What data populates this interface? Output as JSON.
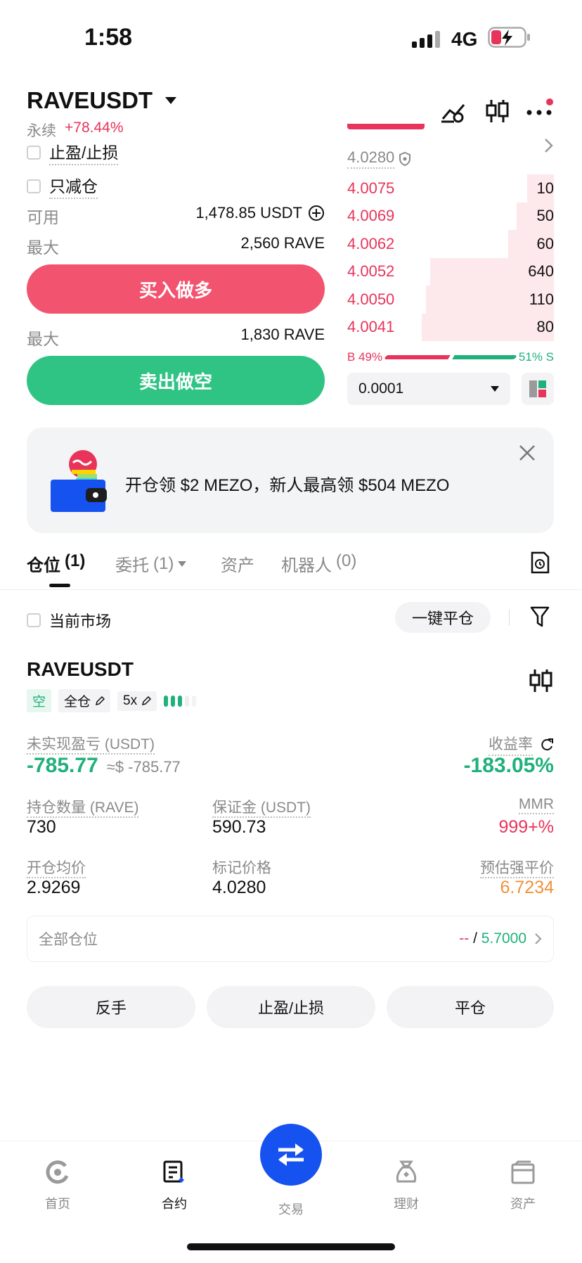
{
  "status": {
    "time": "1:58",
    "network": "4G"
  },
  "header": {
    "pair": "RAVEUSDT",
    "type": "永续",
    "change": "+78.44%"
  },
  "order_form": {
    "tp_sl_label": "止盈/止损",
    "reduce_only_label": "只减仓",
    "available_label": "可用",
    "available_value": "1,478.85 USDT",
    "max_label": "最大",
    "max_buy_value": "2,560 RAVE",
    "buy_button": "买入做多",
    "max_sell_value": "1,830 RAVE",
    "sell_button": "卖出做空"
  },
  "orderbook": {
    "mark_price": "4.0280",
    "asks": [
      {
        "price": "4.0075",
        "qty": "10",
        "depth": 0.13
      },
      {
        "price": "4.0069",
        "qty": "50",
        "depth": 0.18
      },
      {
        "price": "4.0062",
        "qty": "60",
        "depth": 0.22
      },
      {
        "price": "4.0052",
        "qty": "640",
        "depth": 0.6
      },
      {
        "price": "4.0050",
        "qty": "110",
        "depth": 0.62
      },
      {
        "price": "4.0041",
        "qty": "80",
        "depth": 0.64
      }
    ],
    "buy_ratio": "B 49%",
    "sell_ratio": "51% S",
    "buy_percent": 49,
    "tick_size": "0.0001"
  },
  "banner": {
    "text": "开仓领 $2 MEZO，新人最高领 $504 MEZO"
  },
  "tabs": [
    {
      "label": "仓位",
      "count": "(1)"
    },
    {
      "label": "委托",
      "count": "(1)"
    },
    {
      "label": "资产",
      "count": ""
    },
    {
      "label": "机器人",
      "count": "(0)"
    }
  ],
  "positions_toolbar": {
    "current_market_label": "当前市场",
    "close_all_button": "一键平仓"
  },
  "position": {
    "symbol": "RAVEUSDT",
    "side_tag": "空",
    "margin_mode": "全仓",
    "leverage": "5x",
    "unrealized_label": "未实现盈亏 (USDT)",
    "unrealized_value": "-785.77",
    "unrealized_usd": "≈$ -785.77",
    "roe_label": "收益率",
    "roe_value": "-183.05%",
    "size_label": "持仓数量 (RAVE)",
    "size_value": "730",
    "margin_label": "保证金 (USDT)",
    "margin_value": "590.73",
    "mmr_label": "MMR",
    "mmr_value": "999+%",
    "entry_label": "开仓均价",
    "entry_value": "2.9269",
    "mark_label": "标记价格",
    "mark_value": "4.0280",
    "liq_label": "预估强平价",
    "liq_value": "6.7234",
    "all_positions_label": "全部仓位",
    "all_positions_left": "--",
    "all_positions_sep": " / ",
    "all_positions_right": "5.7000",
    "buttons": {
      "reverse": "反手",
      "tpsl": "止盈/止损",
      "close": "平仓"
    }
  },
  "bottom_nav": [
    {
      "label": "首页",
      "icon": "home-icon"
    },
    {
      "label": "合约",
      "icon": "futures-icon"
    },
    {
      "label": "交易",
      "icon": "swap-icon"
    },
    {
      "label": "理财",
      "icon": "earn-icon"
    },
    {
      "label": "资产",
      "icon": "wallet-icon"
    }
  ],
  "colors": {
    "buy": "#f2536e",
    "sell": "#2fc484",
    "accent": "#1652f0"
  }
}
